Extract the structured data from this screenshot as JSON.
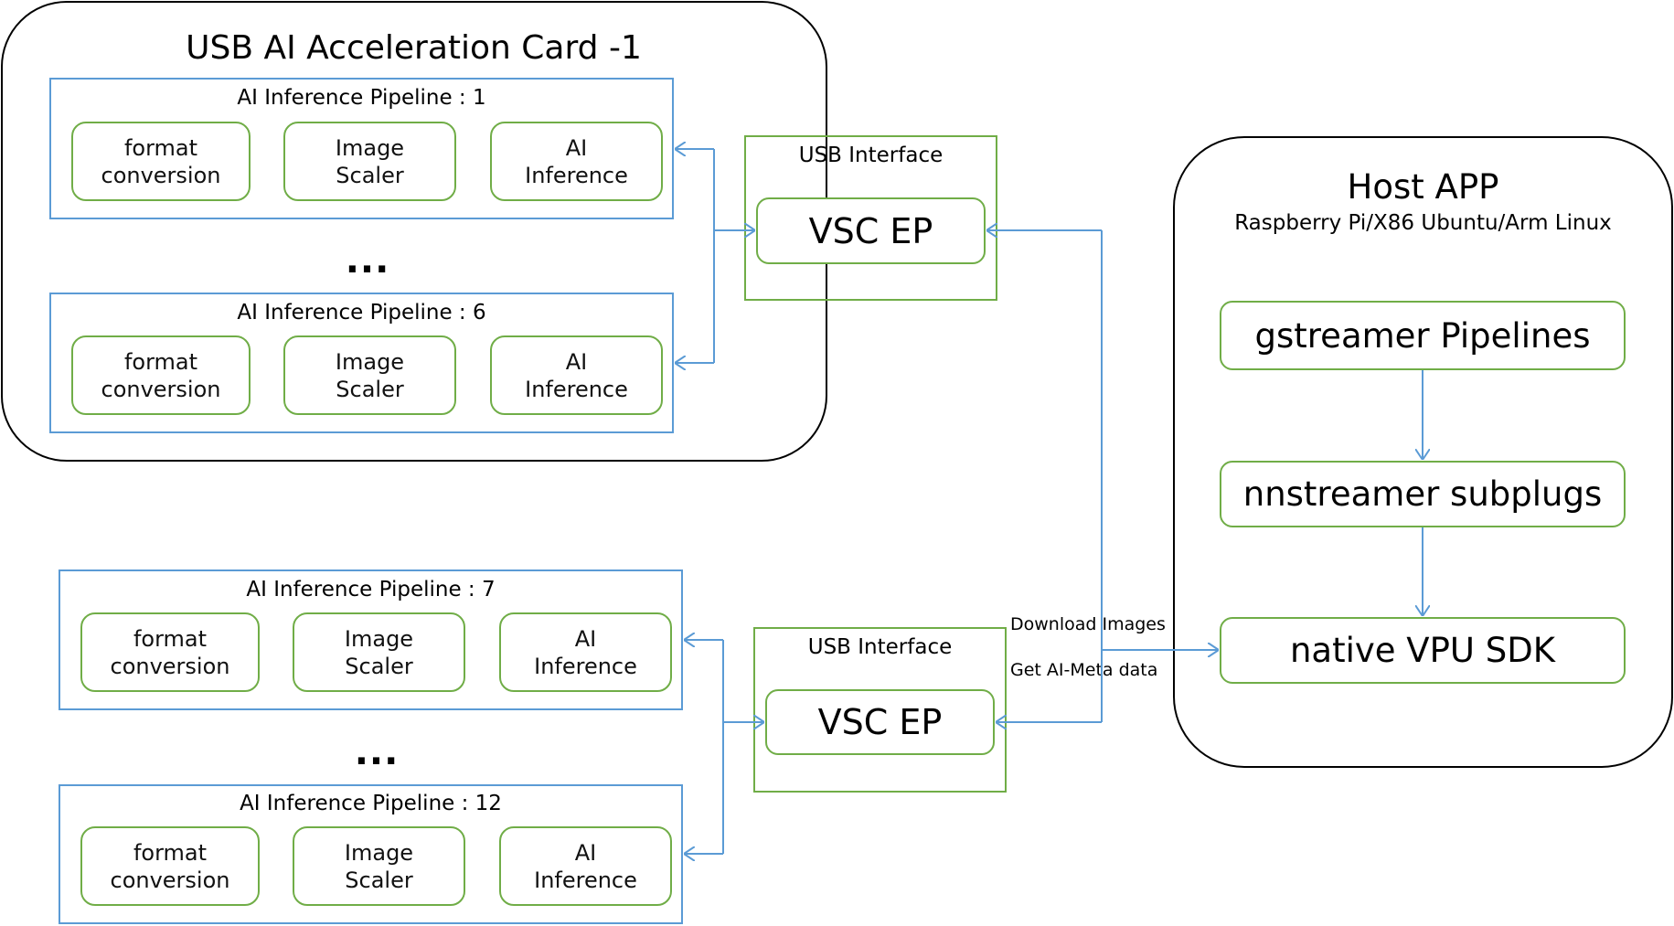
{
  "card": {
    "title": "USB AI Acceleration Card -1",
    "pipelines": [
      {
        "title": "AI  Inference Pipeline : 1",
        "steps": [
          "format\nconversion",
          "Image\nScaler",
          "AI\nInference"
        ]
      },
      {
        "title": "AI  Inference Pipeline : 6",
        "steps": [
          "format\nconversion",
          "Image\nScaler",
          "AI\nInference"
        ]
      }
    ],
    "ellipsis": "...",
    "usb_interface": {
      "title": "USB Interface",
      "endpoint": "VSC EP"
    }
  },
  "card2": {
    "pipelines": [
      {
        "title": "AI  Inference Pipeline : 7",
        "steps": [
          "format\nconversion",
          "Image\nScaler",
          "AI\nInference"
        ]
      },
      {
        "title": "AI  Inference Pipeline : 12",
        "steps": [
          "format\nconversion",
          "Image\nScaler",
          "AI\nInference"
        ]
      }
    ],
    "ellipsis": "...",
    "usb_interface": {
      "title": "USB Interface",
      "endpoint": "VSC EP"
    }
  },
  "host": {
    "title": "Host APP",
    "subtitle": "Raspberry Pi/X86 Ubuntu/Arm Linux",
    "layers": [
      "gstreamer Pipelines",
      "nnstreamer subplugs",
      "native VPU SDK"
    ]
  },
  "flow_labels": {
    "download": "Download Images",
    "meta": "Get AI-Meta data"
  },
  "colors": {
    "pipeline_border": "#5b9bd5",
    "component_border": "#70ad47",
    "card_border": "#000000",
    "wire": "#5b9bd5"
  }
}
